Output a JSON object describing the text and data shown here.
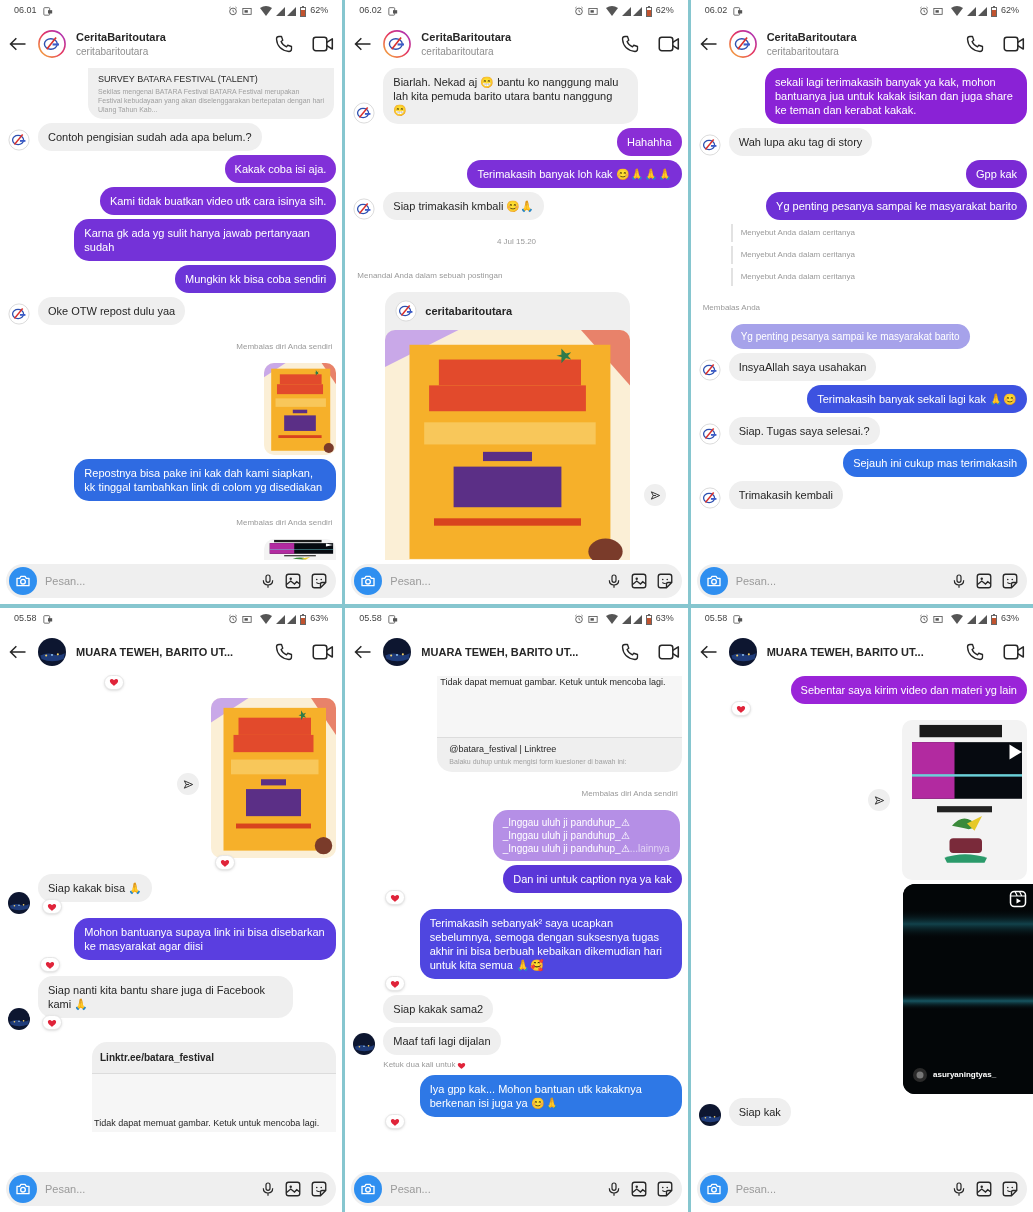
{
  "panels": [
    {
      "status": {
        "time": "06.01",
        "battery": "62%"
      },
      "header": {
        "title": "CeritaBaritoutara",
        "subtitle": "ceritabaritoutara"
      },
      "composer": {
        "placeholder": "Pesan..."
      },
      "messages": [
        {
          "kind": "link_card",
          "title": "SURVEY BATARA FESTIVAL (TALENT)",
          "text": "Sekilas mengenai BATARA Festival BATARA Festival merupakan Festival kebudayaan yang akan diselenggarakan bertepatan dengan hari Ulang Tahun Kab..."
        },
        {
          "kind": "in",
          "avatar": true,
          "text": "Contoh pengisian sudah ada apa belum.?"
        },
        {
          "kind": "out",
          "color": "#8130d8",
          "text": "Kakak coba isi aja."
        },
        {
          "kind": "out",
          "color": "#7a30d8",
          "text": "Kami tidak buatkan video utk cara isinya sih."
        },
        {
          "kind": "out",
          "color": "#7432d8",
          "text": "Karna gk ada yg sulit hanya jawab pertanyaan sudah"
        },
        {
          "kind": "out",
          "color": "#6c34d8",
          "text": "Mungkin kk bisa coba sendiri"
        },
        {
          "kind": "in",
          "avatar": true,
          "text": "Oke OTW repost dulu yaa"
        },
        {
          "kind": "reply_label",
          "text": "Membalas diri Anda sendiri"
        },
        {
          "kind": "poster"
        },
        {
          "kind": "out",
          "color": "#2f6be2",
          "text": "Repostnya bisa pake ini kak dah kami siapkan, kk tinggal tambahkan link di colom yg disediakan"
        },
        {
          "kind": "reply_label",
          "text": "Membalas diri Anda sendiri"
        },
        {
          "kind": "video"
        }
      ]
    },
    {
      "status": {
        "time": "06.02",
        "battery": "62%"
      },
      "header": {
        "title": "CeritaBaritoutara",
        "subtitle": "ceritabaritoutara"
      },
      "composer": {
        "placeholder": "Pesan..."
      },
      "messages": [
        {
          "kind": "in",
          "avatar": true,
          "text": "Biarlah. Nekad aj 😁 bantu ko nanggung malu lah kita pemuda barito utara bantu nanggung 😁"
        },
        {
          "kind": "out",
          "color": "#8a2ed6",
          "text": "Hahahha"
        },
        {
          "kind": "out",
          "color": "#7c30d8",
          "text": "Terimakasih banyak loh kak 😊🙏🙏🙏"
        },
        {
          "kind": "in",
          "avatar": true,
          "text": "Siap trimakasih kmbali 😊🙏"
        },
        {
          "kind": "timestamp",
          "text": "4 Jul 15.20"
        },
        {
          "kind": "label",
          "text": "Menandai Anda dalam sebuah postingan"
        },
        {
          "kind": "post",
          "username": "ceritabaritoutara",
          "share": true
        }
      ]
    },
    {
      "status": {
        "time": "06.02",
        "battery": "62%"
      },
      "header": {
        "title": "CeritaBaritoutara",
        "subtitle": "ceritabaritoutara"
      },
      "composer": {
        "placeholder": "Pesan..."
      },
      "messages": [
        {
          "kind": "out",
          "color": "#8a22d6",
          "text": "sekali lagi terimakasih banyak ya kak, mohon bantuanya jua untuk kakak isikan dan juga share ke teman dan kerabat kakak."
        },
        {
          "kind": "in",
          "avatar": true,
          "text": "Wah lupa aku tag di story"
        },
        {
          "kind": "out",
          "color": "#7a2ad4",
          "text": "Gpp kak"
        },
        {
          "kind": "out",
          "color": "#6e30d6",
          "text": "Yg penting pesanya sampai ke masyarakat barito"
        },
        {
          "kind": "mention",
          "text": "Menyebut Anda dalam ceritanya"
        },
        {
          "kind": "mention",
          "text": "Menyebut Anda dalam ceritanya"
        },
        {
          "kind": "mention",
          "text": "Menyebut Anda dalam ceritanya"
        },
        {
          "kind": "label",
          "text": "Membalas Anda"
        },
        {
          "kind": "quote",
          "lines": [
            "Yg penting pesanya sampai ke masyarakat barito"
          ]
        },
        {
          "kind": "in",
          "avatar": true,
          "text": "InsyaAllah saya usahakan"
        },
        {
          "kind": "out",
          "color": "#3d52e0",
          "text": "Terimakasih banyak sekali lagi kak 🙏😊"
        },
        {
          "kind": "in",
          "avatar": true,
          "text": "Siap. Tugas saya selesai.?"
        },
        {
          "kind": "out",
          "color": "#2e6fe6",
          "text": "Sejauh ini cukup mas terimakasih"
        },
        {
          "kind": "in",
          "avatar": true,
          "text": "Trimakasih kembali"
        }
      ]
    },
    {
      "status": {
        "time": "05.58",
        "battery": "63%"
      },
      "header": {
        "title": "MUARA TEWEH, BARITO UT..."
      },
      "composer": {
        "placeholder": "Pesan..."
      },
      "messages": [
        {
          "kind": "reaction_only",
          "reaction": true
        },
        {
          "kind": "poster",
          "share": true,
          "reaction": true
        },
        {
          "kind": "in",
          "avatar": true,
          "text": "Siap kakak bisa 🙏",
          "reaction": true
        },
        {
          "kind": "out",
          "color": "#5a3ee0",
          "text": "Mohon bantuanya supaya link ini bisa disebarkan ke masyarakat agar diisi",
          "reaction": true
        },
        {
          "kind": "in",
          "avatar": true,
          "text": "Siap nanti kita bantu share juga di Facebook kami 🙏",
          "reaction": true
        },
        {
          "kind": "link_preview",
          "title": "Linktr.ee/batara_festival",
          "error": "Tidak dapat memuat gambar. Ketuk untuk mencoba lagi."
        }
      ]
    },
    {
      "status": {
        "time": "05.58",
        "battery": "63%"
      },
      "header": {
        "title": "MUARA TEWEH, BARITO UT..."
      },
      "composer": {
        "placeholder": "Pesan..."
      },
      "messages": [
        {
          "kind": "link_card_error",
          "error": "Tidak dapat memuat gambar. Ketuk untuk mencoba lagi.",
          "title": "@batara_festival | Linktree",
          "text": "Balaku duhup untuk mengisi form kuesioner di bawah ini:"
        },
        {
          "kind": "reply_label",
          "text": "Membalas diri Anda sendiri"
        },
        {
          "kind": "reply_quote",
          "lines": [
            "_Inggau uluh ji panduhup_⚠",
            "_Inggau uluh ji panduhup_⚠",
            "_Inggau uluh ji panduhup_⚠"
          ],
          "more": "...lainnya"
        },
        {
          "kind": "out",
          "color": "#5a36d8",
          "text": "Dan ini untuk caption nya ya kak",
          "reaction": true
        },
        {
          "kind": "out",
          "color": "#4f46e0",
          "text": "Terimakasih sebanyak² saya ucapkan sebelumnya, semoga dengan suksesnya tugas akhir ini bisa berbuah kebaikan dikemudian hari untuk kita semua 🙏🥰",
          "reaction": true
        },
        {
          "kind": "in",
          "avatar": false,
          "text": "Siap kakak sama2"
        },
        {
          "kind": "in",
          "avatar": true,
          "text": "Maaf tafi lagi dijalan"
        },
        {
          "kind": "hint",
          "text": "Ketuk dua kali untuk"
        },
        {
          "kind": "out",
          "color": "#2e78e6",
          "text": "Iya gpp kak... Mohon bantuan utk kakaknya berkenan isi juga ya 😊🙏",
          "reaction": true
        }
      ]
    },
    {
      "status": {
        "time": "05.58",
        "battery": "63%"
      },
      "header": {
        "title": "MUARA TEWEH, BARITO UT..."
      },
      "composer": {
        "placeholder": "Pesan..."
      },
      "messages": [
        {
          "kind": "out",
          "color": "#9a24d8",
          "text": "Sebentar saya kirim video dan materi yg lain",
          "reaction": true
        },
        {
          "kind": "video",
          "share": true
        },
        {
          "kind": "reel",
          "username": "asuryaningtyas_"
        },
        {
          "kind": "in",
          "avatar": true,
          "text": "Siap kak"
        }
      ]
    }
  ]
}
